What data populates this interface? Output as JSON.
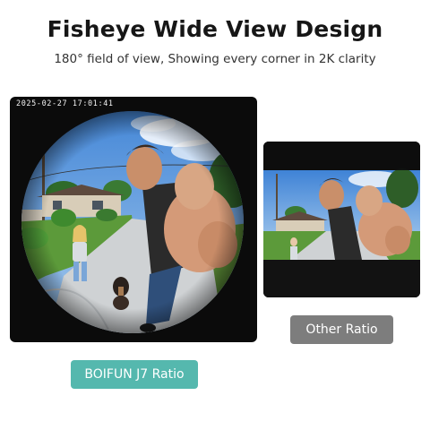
{
  "header": {
    "title": "Fisheye Wide View Design",
    "subtitle": "180° field of view,  Showing every corner in 2K clarity"
  },
  "fisheye_view": {
    "timestamp": "2025-02-27  17:01:41",
    "label": "BOIFUN J7 Ratio"
  },
  "other_view": {
    "label": "Other Ratio"
  },
  "colors": {
    "j7_badge": "#55b8ae",
    "other_badge": "#7d7d7d",
    "panel_background": "#0b0b0b"
  }
}
